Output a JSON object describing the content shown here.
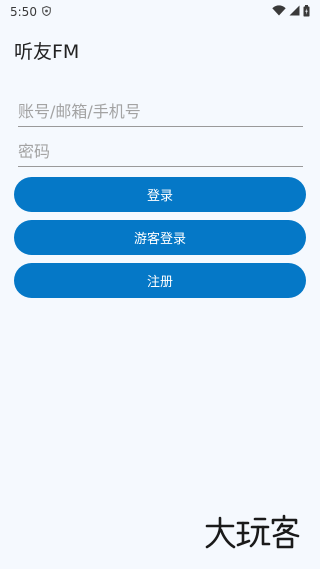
{
  "status_bar": {
    "time": "5:50",
    "icons": [
      "shield-icon",
      "wifi-icon",
      "signal-icon",
      "battery-icon"
    ]
  },
  "app": {
    "title": "听友FM"
  },
  "form": {
    "account_placeholder": "账号/邮箱/手机号",
    "account_value": "",
    "password_placeholder": "密码",
    "password_value": ""
  },
  "buttons": {
    "login": "登录",
    "guest_login": "游客登录",
    "register": "注册"
  },
  "watermark": {
    "text": "大玩客"
  },
  "colors": {
    "accent": "#0578c7",
    "background": "#f5f9fe"
  }
}
